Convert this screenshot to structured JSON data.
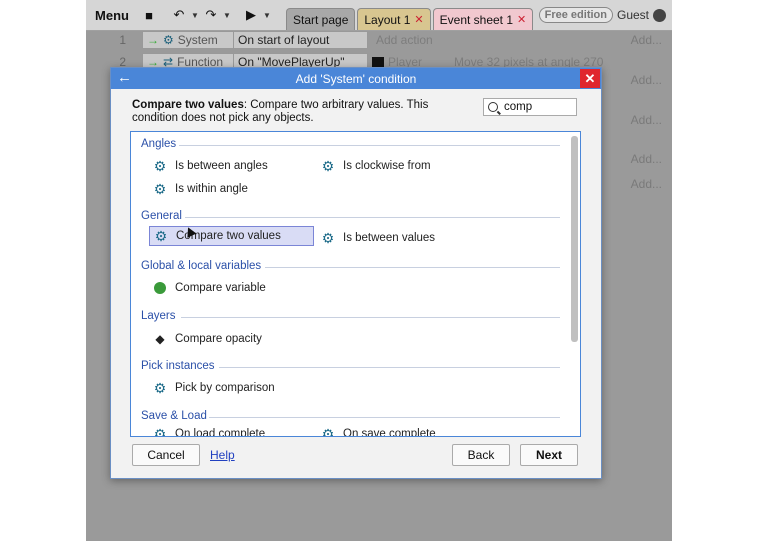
{
  "toolbar": {
    "menu_label": "Menu",
    "icons": [
      "save-icon",
      "undo-icon",
      "redo-icon",
      "play-icon"
    ],
    "tabs": [
      {
        "label": "Start page",
        "closable": false
      },
      {
        "label": "Layout 1",
        "closable": true
      },
      {
        "label": "Event sheet 1",
        "closable": true
      }
    ],
    "edition_badge": "Free edition",
    "user_label": "Guest"
  },
  "events": [
    {
      "num": "1",
      "object": "System",
      "condition": "On start of layout",
      "action": "Add action",
      "add": "Add..."
    },
    {
      "num": "2",
      "object": "Function",
      "condition": "On \"MovePlayerUp\"",
      "action_object": "Player",
      "action": "Move 32 pixels at angle 270",
      "add": "Add..."
    }
  ],
  "side_add_labels": [
    "Add...",
    "Add...",
    "Add...",
    "Add..."
  ],
  "dialog": {
    "title": "Add 'System' condition",
    "desc_bold": "Compare two values",
    "desc_text": ": Compare two arbitrary values. This condition does not pick any objects.",
    "search_value": "comp",
    "sections": [
      {
        "title": "Angles",
        "items": [
          {
            "label": "Is between angles",
            "icon": "gear-icon"
          },
          {
            "label": "Is clockwise from",
            "icon": "gear-icon"
          },
          {
            "label": "Is within angle",
            "icon": "gear-icon"
          }
        ]
      },
      {
        "title": "General",
        "items": [
          {
            "label": "Compare two values",
            "icon": "gear-icon",
            "selected": true
          },
          {
            "label": "Is between values",
            "icon": "gear-icon"
          }
        ]
      },
      {
        "title": "Global & local variables",
        "items": [
          {
            "label": "Compare variable",
            "icon": "globe-icon"
          }
        ]
      },
      {
        "title": "Layers",
        "items": [
          {
            "label": "Compare opacity",
            "icon": "layers-icon"
          }
        ]
      },
      {
        "title": "Pick instances",
        "items": [
          {
            "label": "Pick by comparison",
            "icon": "gear-icon"
          }
        ]
      },
      {
        "title": "Save & Load",
        "items": [
          {
            "label": "On load complete",
            "icon": "gear-icon"
          },
          {
            "label": "On save complete",
            "icon": "gear-icon"
          }
        ]
      }
    ],
    "buttons": {
      "cancel": "Cancel",
      "help": "Help",
      "back": "Back",
      "next": "Next"
    }
  },
  "colors": {
    "title_bar": "#4a86d8",
    "close": "#e0262e",
    "section_title": "#2b50a8",
    "selected_bg": "#d9dcf5"
  }
}
